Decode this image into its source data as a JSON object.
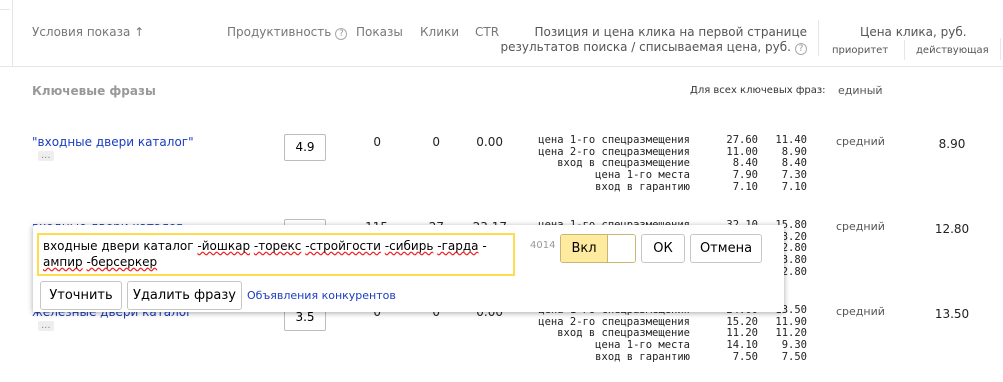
{
  "header": {
    "conditions": "Условия показа",
    "sort_arrow": "↑",
    "productivity": "Продуктивность",
    "shows": "Показы",
    "clicks": "Клики",
    "ctr": "CTR",
    "position_line1": "Позиция и цена клика на первой странице",
    "position_line2": "результатов поиска / списываемая цена, руб.",
    "price": "Цена клика, руб.",
    "priority": "приоритет",
    "current": "действующая",
    "help_glyph": "?"
  },
  "section": {
    "title": "Ключевые фразы",
    "all_phrases_label": "Для всех ключевых фраз:",
    "all_phrases_value": "единый"
  },
  "rows": [
    {
      "keyword": "\"входные двери каталог\"",
      "dots": "...",
      "productivity": "4.9",
      "shows": "0",
      "clicks": "0",
      "ctr": "0.00",
      "positions": [
        {
          "label": "цена 1-го спецразмещения",
          "v1": "27.60",
          "v2": "11.40"
        },
        {
          "label": "цена 2-го спецразмещения",
          "v1": "11.00",
          "v2": "8.90"
        },
        {
          "label": "вход в спецразмещение",
          "v1": "8.40",
          "v2": "8.40"
        },
        {
          "label": "цена 1-го места",
          "v1": "7.90",
          "v2": "7.30"
        },
        {
          "label": "вход в гарантию",
          "v1": "7.10",
          "v2": "7.10"
        }
      ],
      "priority": "средний",
      "current": "8.90"
    },
    {
      "keyword": "входные двери каталог",
      "dots": "...",
      "productivity": "",
      "shows": "115",
      "clicks": "27",
      "ctr": "23.17",
      "positions": [
        {
          "label": "цена 1-го спецразмещения",
          "v1": "32.10",
          "v2": "15.80"
        },
        {
          "label": "",
          "v1": "",
          "v2": "13.20"
        },
        {
          "label": "",
          "v1": "",
          "v2": "12.80"
        },
        {
          "label": "",
          "v1": "",
          "v2": "13.80"
        },
        {
          "label": "",
          "v1": "",
          "v2": "12.80"
        }
      ],
      "priority": "средний",
      "current": "12.80"
    },
    {
      "keyword": "железные двери каталог",
      "dots": "...",
      "productivity": "3.5",
      "shows": "0",
      "clicks": "0",
      "ctr": "0.00",
      "positions": [
        {
          "label": "цена 1-го спецразмещения",
          "v1": "24.00",
          "v2": "13.50"
        },
        {
          "label": "цена 2-го спецразмещения",
          "v1": "15.20",
          "v2": "11.90"
        },
        {
          "label": "вход в спецразмещение",
          "v1": "11.20",
          "v2": "11.20"
        },
        {
          "label": "цена 1-го места",
          "v1": "14.10",
          "v2": "9.30"
        },
        {
          "label": "вход в гарантию",
          "v1": "7.50",
          "v2": "7.50"
        }
      ],
      "priority": "средний",
      "current": "13.50"
    }
  ],
  "popup": {
    "phrase_plain": "входные двери каталог ",
    "minus_words": [
      "-йошкар",
      "-торекс",
      "-стройгости",
      "-сибирь",
      "-гарда",
      "-ампир",
      "-берсеркер"
    ],
    "char_count": "4014",
    "toggle_label": "Вкл",
    "ok_label": "ОК",
    "cancel_label": "Отмена",
    "refine_label": "Уточнить",
    "delete_label": "Удалить фразу",
    "competitors_link": "Объявления конкурентов"
  },
  "colors": {
    "link": "#1a3dc1",
    "focus_border": "#ffdb4d",
    "toggle_on": "#ffeba0"
  }
}
